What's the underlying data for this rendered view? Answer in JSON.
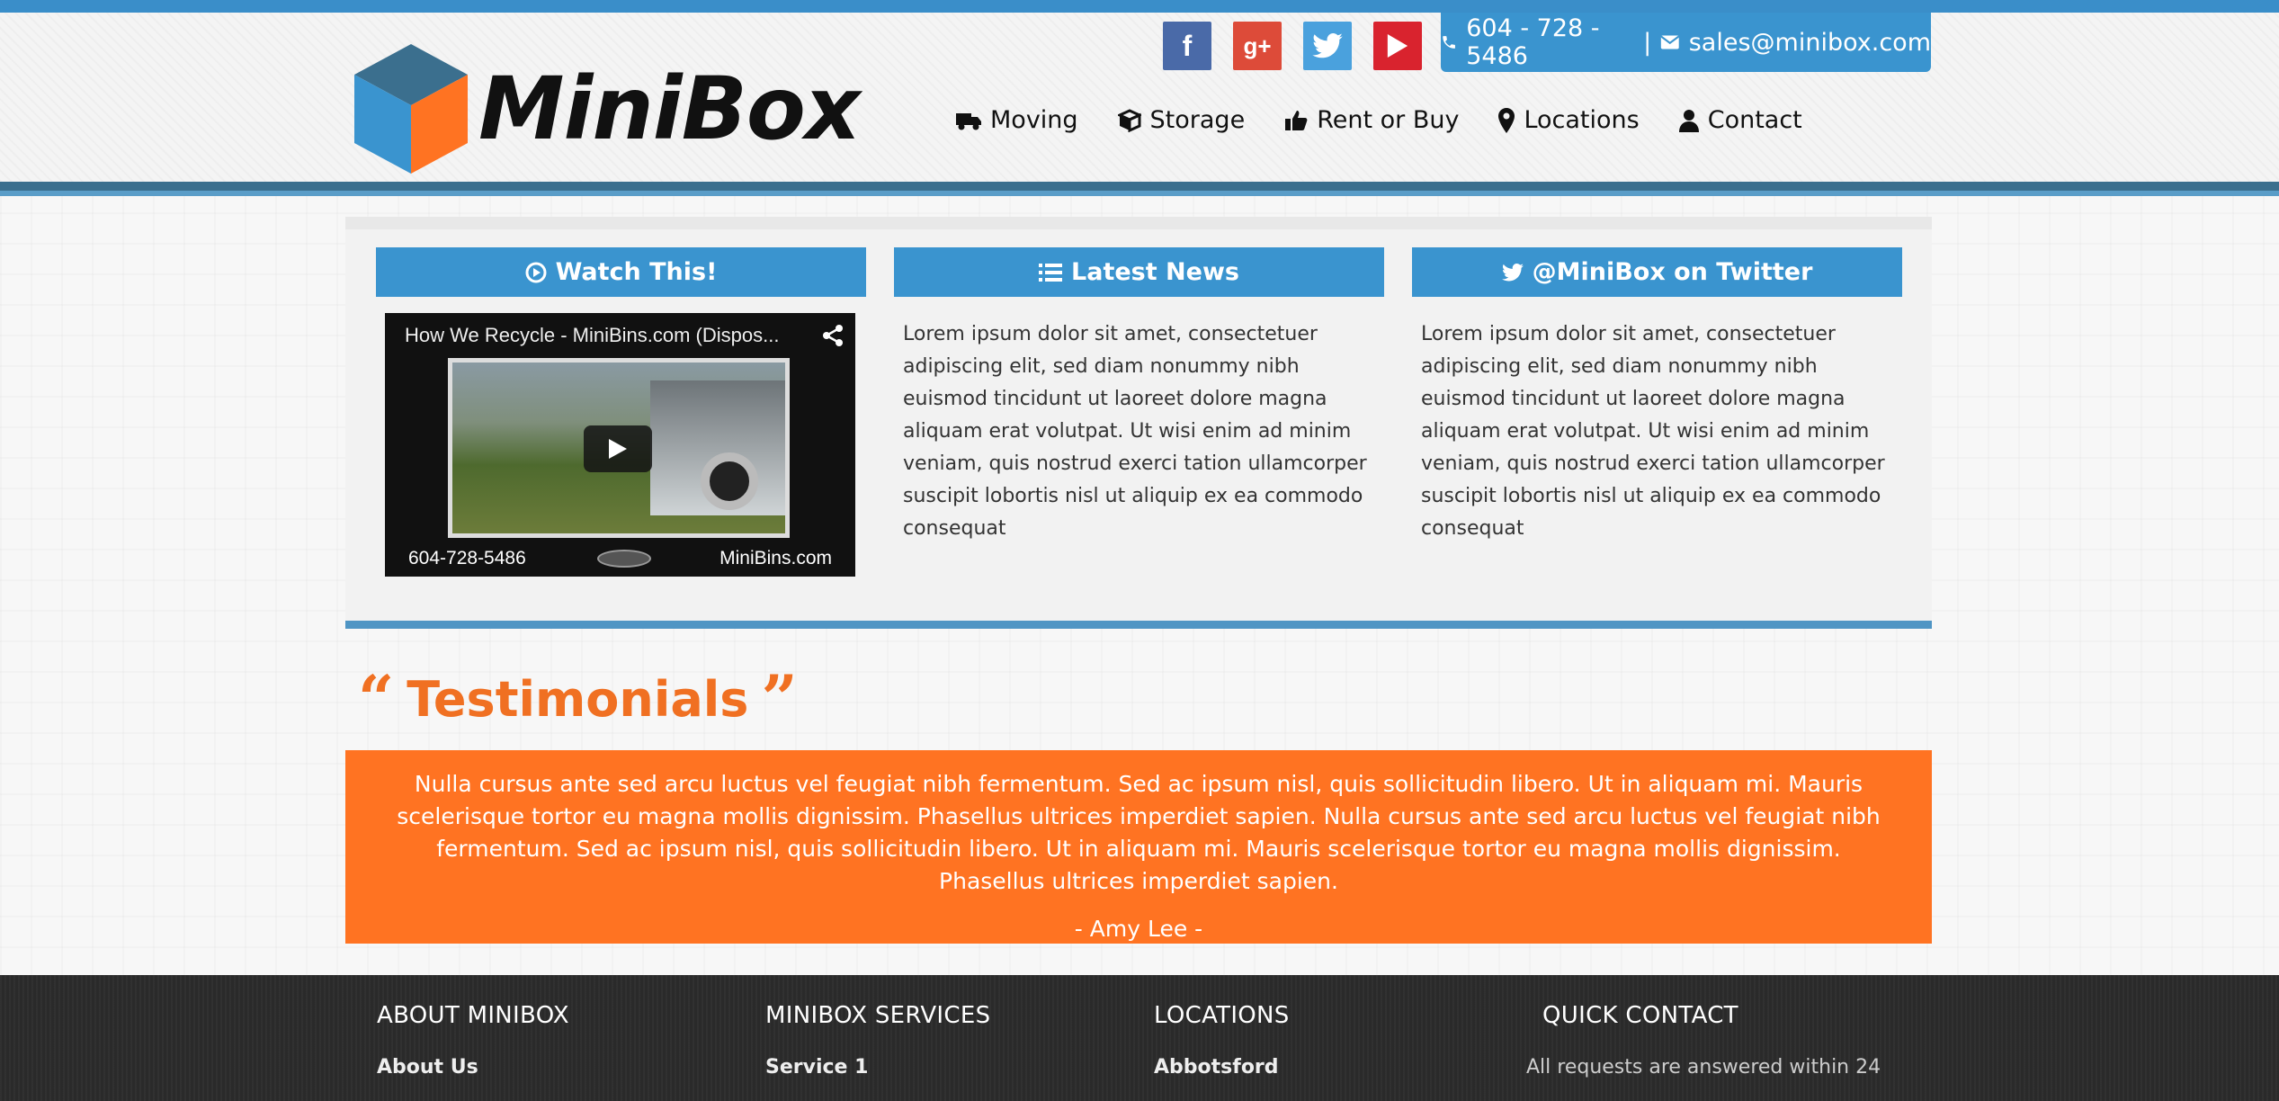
{
  "brand": {
    "name": "MiniBox",
    "accent": "#3a94cf",
    "orange": "#ff7322"
  },
  "social": [
    {
      "name": "facebook-icon",
      "glyph": "f"
    },
    {
      "name": "google-plus-icon",
      "glyph": "g+"
    },
    {
      "name": "twitter-icon",
      "glyph": ""
    },
    {
      "name": "youtube-icon",
      "glyph": ""
    }
  ],
  "contact": {
    "phone": "604 - 728 - 5486",
    "separator": "|",
    "email": "sales@minibox.com"
  },
  "nav": [
    {
      "label": "Moving",
      "icon": "truck-icon"
    },
    {
      "label": "Storage",
      "icon": "box-icon"
    },
    {
      "label": "Rent or Buy",
      "icon": "thumbs-up-icon"
    },
    {
      "label": "Locations",
      "icon": "map-marker-icon"
    },
    {
      "label": "Contact",
      "icon": "user-icon"
    }
  ],
  "columns": {
    "watch": {
      "title": "Watch This!"
    },
    "news": {
      "title": "Latest News",
      "text": "Lorem ipsum dolor sit amet, consectetuer adipiscing elit, sed diam nonummy nibh euismod tincidunt ut laoreet dolore magna aliquam erat volutpat. Ut wisi enim ad minim veniam, quis nostrud exerci tation ullamcorper suscipit lobortis nisl ut aliquip ex ea commodo consequat"
    },
    "twitter": {
      "title": "@MiniBox on Twitter",
      "text": "Lorem ipsum dolor sit amet, consectetuer adipiscing elit, sed diam nonummy nibh euismod tincidunt ut laoreet dolore magna aliquam erat volutpat. Ut wisi enim ad minim veniam, quis nostrud exerci tation ullamcorper suscipit lobortis nisl ut aliquip ex ea commodo consequat"
    }
  },
  "video": {
    "title": "How We Recycle - MiniBins.com (Dispos...",
    "phone": "604-728-5486",
    "site": "MiniBins.com"
  },
  "testimonials": {
    "title": "Testimonials",
    "text": "Nulla cursus ante sed arcu luctus vel feugiat nibh fermentum. Sed ac ipsum nisl, quis sollicitudin libero. Ut in aliquam mi. Mauris scelerisque tortor eu magna mollis dignissim. Phasellus ultrices imperdiet sapien. Nulla cursus ante sed arcu luctus vel feugiat nibh fermentum. Sed ac ipsum nisl, quis sollicitudin libero. Ut in aliquam mi. Mauris scelerisque tortor eu magna mollis dignissim. Phasellus ultrices imperdiet sapien.",
    "author": "- Amy Lee -"
  },
  "footer": {
    "about": {
      "title": "ABOUT MINIBOX",
      "link": "About Us"
    },
    "services": {
      "title": "MINIBOX SERVICES",
      "link": "Service 1"
    },
    "locations": {
      "title": "LOCATIONS",
      "link": "Abbotsford"
    },
    "quick": {
      "title": "QUICK CONTACT",
      "text": "All requests are answered within 24"
    }
  }
}
